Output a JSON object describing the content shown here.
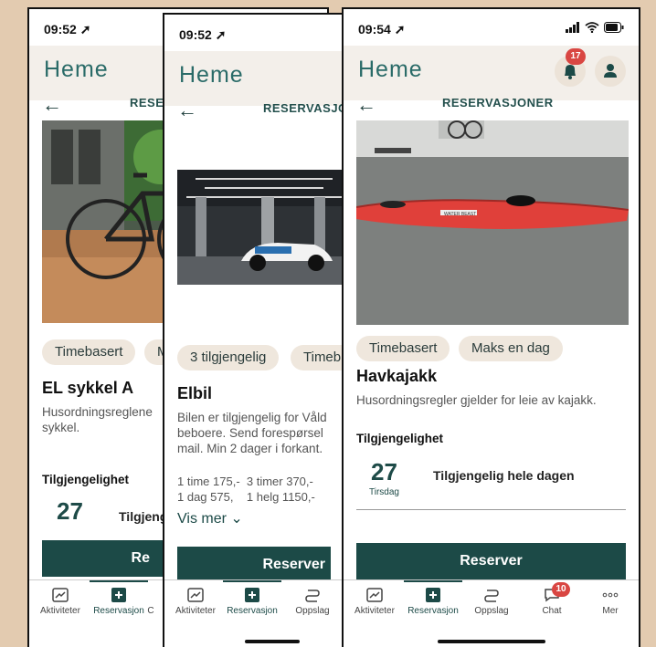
{
  "brand": {
    "logo": "Heme",
    "accent": "#1c4a47",
    "badge_color": "#d94642"
  },
  "phone1": {
    "time": "09:52",
    "section": "RESER",
    "chips": [
      "Timebasert",
      "M"
    ],
    "title": "EL sykkel A",
    "description": "Husordningsreglene sykkel.",
    "availability_title": "Tilgjengelighet",
    "day_num": "27",
    "avail_text": "Tilgjeng",
    "reserve": "Re",
    "tabs": [
      "Aktiviteter",
      "Reservasjon",
      "C"
    ]
  },
  "phone2": {
    "time": "09:52",
    "section": "RESERVASJO",
    "chips": [
      "3 tilgjengelig",
      "Timeb"
    ],
    "title": "Elbil",
    "description": "Bilen er tilgjengelig for Våld beboere. Send forespørsel mail. Min 2 dager i forkant.",
    "prices": "1 time 175,-  3 timer 370,-\n1 dag 575,    1 helg 1150,-",
    "vis_mer": "Vis mer",
    "reserve": "Reserver",
    "tabs": [
      "Aktiviteter",
      "Reservasjon",
      "Oppslag"
    ]
  },
  "phone3": {
    "time": "09:54",
    "notification_count": "17",
    "section": "RESERVASJONER",
    "chips": [
      "Timebasert",
      "Maks en dag"
    ],
    "title": "Havkajakk",
    "description": "Husordningsregler gjelder for leie av kajakk.",
    "availability_title": "Tilgjengelighet",
    "day_num": "27",
    "day_name": "Tirsdag",
    "avail_text": "Tilgjengelig hele dagen",
    "reserve": "Reserver",
    "kayak_label": "WATER BEAST",
    "tabs": [
      "Aktiviteter",
      "Reservasjon",
      "Oppslag",
      "Chat",
      "Mer"
    ],
    "chat_badge": "10"
  }
}
